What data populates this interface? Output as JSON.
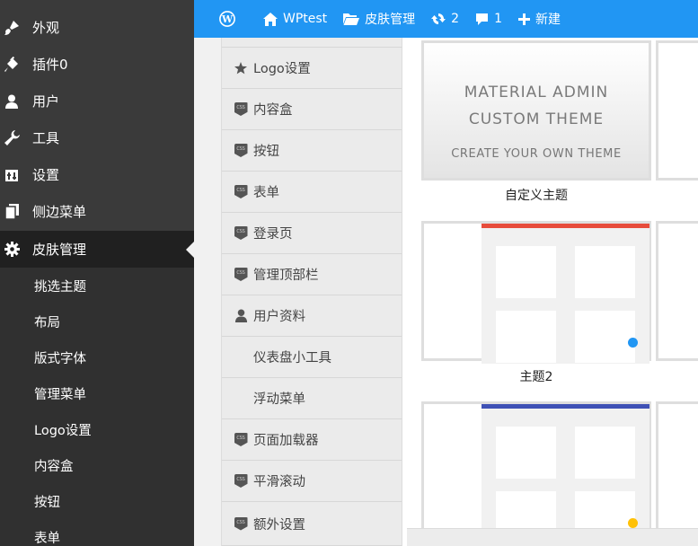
{
  "topbar": {
    "site_name": "WPtest",
    "skin_label": "皮肤管理",
    "updates_count": "2",
    "comments_count": "1",
    "new_label": "新建"
  },
  "sidebar": {
    "items": [
      {
        "label": "外观",
        "icon": "brush-icon"
      },
      {
        "label": "插件0",
        "icon": "plugin-icon"
      },
      {
        "label": "用户",
        "icon": "user-icon"
      },
      {
        "label": "工具",
        "icon": "wrench-icon"
      },
      {
        "label": "设置",
        "icon": "settings-icon"
      },
      {
        "label": "侧边菜单",
        "icon": "pages-icon"
      },
      {
        "label": "皮肤管理",
        "icon": "gear-icon"
      }
    ],
    "submenu": [
      "挑选主题",
      "布局",
      "版式字体",
      "管理菜单",
      "Logo设置",
      "内容盒",
      "按钮",
      "表单"
    ]
  },
  "settings_nav": {
    "items": [
      {
        "label": "Logo设置",
        "icon": "star-icon"
      },
      {
        "label": "内容盒",
        "icon": "css-icon"
      },
      {
        "label": "按钮",
        "icon": "css-icon"
      },
      {
        "label": "表单",
        "icon": "css-icon"
      },
      {
        "label": "登录页",
        "icon": "css-icon"
      },
      {
        "label": "管理顶部栏",
        "icon": "css-icon"
      },
      {
        "label": "用户资料",
        "icon": "user-icon"
      },
      {
        "label": "仪表盘小工具",
        "icon": ""
      },
      {
        "label": "浮动菜单",
        "icon": ""
      },
      {
        "label": "页面加载器",
        "icon": "css-icon"
      },
      {
        "label": "平滑滚动",
        "icon": "css-icon"
      },
      {
        "label": "额外设置",
        "icon": "css-icon"
      }
    ],
    "css_badge_text": "CSS"
  },
  "themes": {
    "custom": {
      "title_line1": "MATERIAL ADMIN",
      "title_line2": "CUSTOM THEME",
      "subtitle": "CREATE YOUR OWN THEME",
      "caption": "自定义主题"
    },
    "theme2": {
      "caption": "主题2",
      "strip_color": "#e74c3c",
      "dot_color": "#2196f3"
    },
    "theme3": {
      "strip_color": "#3f51b5",
      "dot_color": "#ffc107"
    }
  },
  "colors": {
    "topbar": "#2196f3",
    "sidebar": "#3a3a3a",
    "sidebar_active": "#202020"
  }
}
